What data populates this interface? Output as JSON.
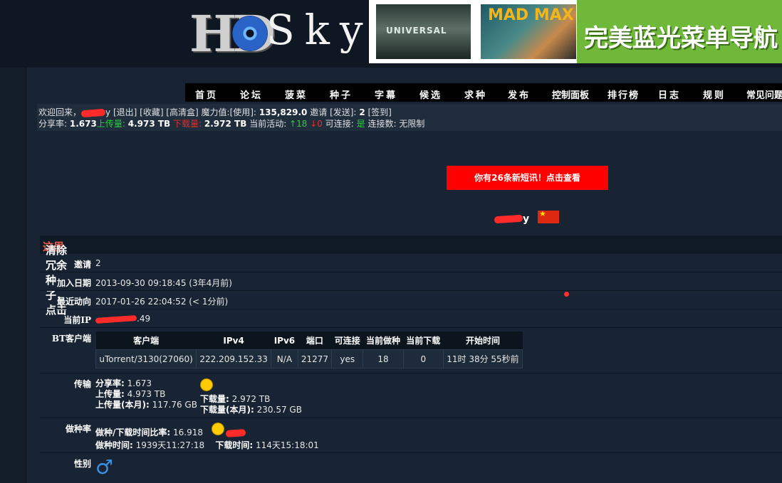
{
  "logo": {
    "hd": "HD",
    "sky": "Sky"
  },
  "banner": {
    "universal": "UNIVERSAL",
    "madmax": "MAD MAX",
    "slogan": "完美蓝光菜单导航"
  },
  "nav": [
    "首页",
    "论坛",
    "菠菜",
    "种子",
    "字幕",
    "候选",
    "求种",
    "发布",
    "控制面板",
    "排行榜",
    "日志",
    "规则",
    "常见问题"
  ],
  "userbar": {
    "line1": {
      "welcome": "欢迎回来，",
      "name_tail": "y",
      "links": "[退出] [收藏] [高清盒]",
      "magic_label": "魔力值:",
      "magic_use": "[使用]:",
      "magic_value": "135,829.0",
      "invite_label": "邀请",
      "invite_send": "[发送]:",
      "invite_value": "2",
      "signin": "[签到]"
    },
    "line2": {
      "ratio_label": "分享率:",
      "ratio_value": "1.673",
      "up_label": "上传量:",
      "up_value": "4.973 TB",
      "down_label": "下载量:",
      "down_value": "2.972 TB",
      "active_label": "当前活动:",
      "active_up": "↑18",
      "active_down": "↓0",
      "connect_label": "可连接:",
      "connect_value": "是",
      "conns_label": "连接数:",
      "conns_value": "无限制"
    }
  },
  "message_box": "你有26条新短讯！点击查看",
  "profile_name_tail": "y",
  "flag_icon": "china-flag-icon",
  "info_title": {
    "text": "清除冗余种子，点击",
    "link": "这里"
  },
  "rows": {
    "invite": {
      "label": "邀请",
      "value": "2"
    },
    "joined": {
      "label": "加入日期",
      "value": "2013-09-30 09:18:45 (3年4月前)"
    },
    "last": {
      "label": "最近动向",
      "value": "2017-01-26 22:04:52 (< 1分前)"
    },
    "ip": {
      "label": "当前IP",
      "value_tail": ".49"
    },
    "bt": {
      "label": "BT客户端"
    },
    "transfer": {
      "label": "传输",
      "ratio_label": "分享率:",
      "ratio_value": "1.673",
      "up_label": "上传量:",
      "up_value": "4.973 TB",
      "down_label": "下载量:",
      "down_value": "2.972 TB",
      "up_month_label": "上传量(本月):",
      "up_month_value": "117.76 GB",
      "down_month_label": "下载量(本月):",
      "down_month_value": "230.57 GB"
    },
    "seed": {
      "label": "做种率",
      "ratio_label": "做种/下载时间比率:",
      "ratio_value": "16.918",
      "seed_time_label": "做种时间:",
      "seed_time_value": "1939天11:27:18",
      "down_time_label": "下载时间:",
      "down_time_value": "114天15:18:01"
    },
    "gender": {
      "label": "性别",
      "icon": "male-symbol-icon",
      "symbol": "♂"
    }
  },
  "bt_table": {
    "headers": [
      "客户端",
      "IPv4",
      "IPv6",
      "端口",
      "可连接",
      "当前做种",
      "当前下载",
      "开始时间"
    ],
    "row": [
      "uTorrent/3130(27060)",
      "222.209.152.33",
      "N/A",
      "21277",
      "yes",
      "18",
      "0",
      "11时 38分 55秒前"
    ]
  }
}
